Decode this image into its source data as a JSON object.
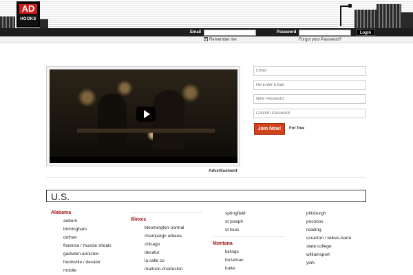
{
  "header": {
    "logo_top": "AD",
    "logo_bottom": "HOOKS",
    "email_label": "Email",
    "password_label": "Password",
    "login_label": "Login",
    "remember_label": "Remember me",
    "remember_check": "✔",
    "forgot_label": "Forgot your Password?"
  },
  "video": {
    "ad_label": "Advertisement"
  },
  "signup": {
    "email_placeholder": "Email",
    "reemail_placeholder": "Re-Enter Email",
    "newpass_placeholder": "New Password",
    "confirm_placeholder": "Confirm Password",
    "join_label": "Join Now!",
    "free_label": "For free"
  },
  "us": {
    "title": "U.S.",
    "col1": {
      "state": "Alabama",
      "cities": [
        "auburn",
        "birmingham",
        "dothan",
        "florence / muscle shoals",
        "gadsden-anniston",
        "huntsville / decatur",
        "mobile"
      ]
    },
    "col2": {
      "state": "Illinois",
      "cities": [
        "bloomington-normal",
        "champaign urbana",
        "chicago",
        "decatur",
        "la salle co",
        "mattoon-charleston"
      ]
    },
    "col3": {
      "cities_top": [
        "springfield",
        "st joseph",
        "st louis"
      ],
      "state": "Montana",
      "cities": [
        "billings",
        "bozeman",
        "butte"
      ]
    },
    "col4": {
      "cities": [
        "pittsburgh",
        "poconos",
        "reading",
        "scranton / wilkes-barre",
        "state college",
        "williamsport",
        "york"
      ]
    }
  },
  "colors": {
    "accent_orange": "#d0431e",
    "state_red": "#a01414",
    "header_dark": "#1e1e1e"
  }
}
